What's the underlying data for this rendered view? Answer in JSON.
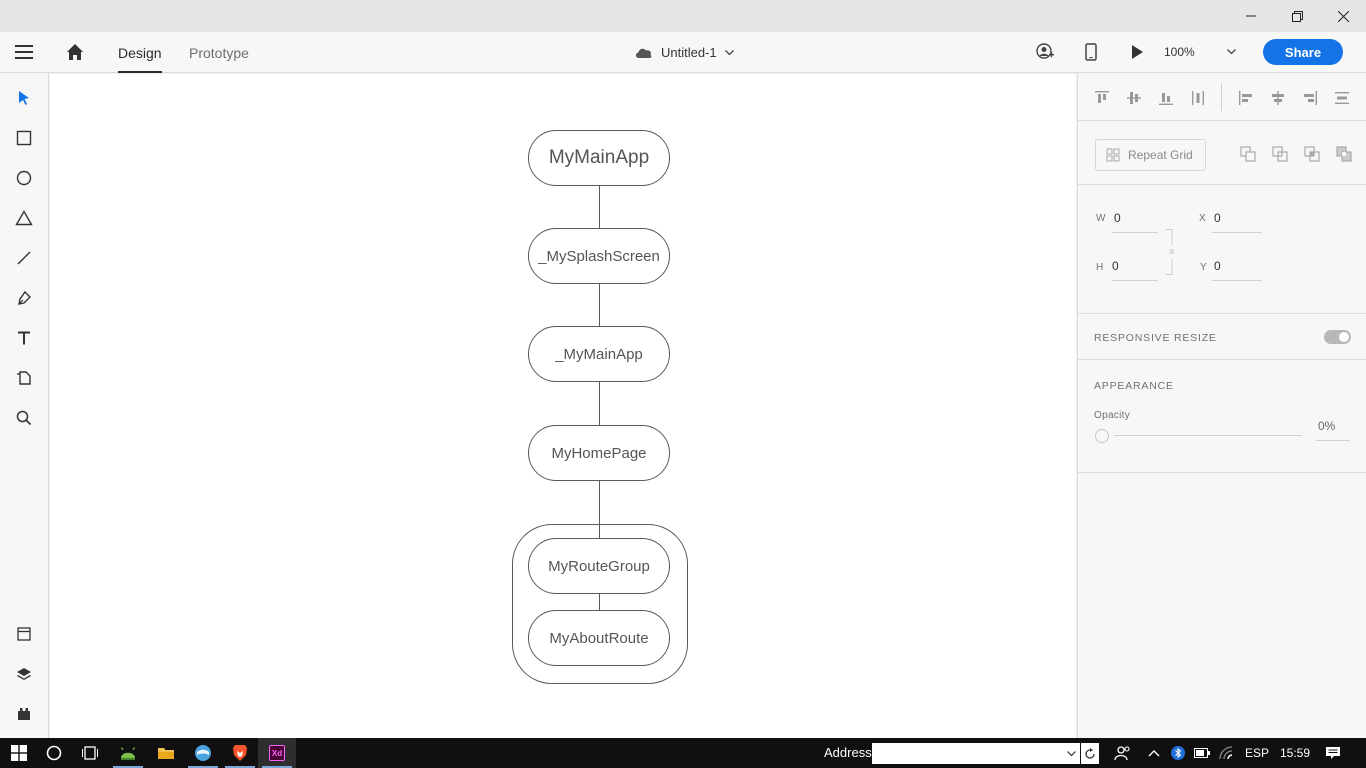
{
  "app": {
    "doc_title": "Untitled-1"
  },
  "tabs": {
    "design": "Design",
    "prototype": "Prototype"
  },
  "toolbar_right": {
    "zoom": "100%",
    "share": "Share"
  },
  "canvas": {
    "nodes": {
      "main_app": "MyMainApp",
      "splash": "_MySplashScreen",
      "priv_main_app": "_MyMainApp",
      "home_page": "MyHomePage",
      "route_group": "MyRouteGroup",
      "about_route": "MyAboutRoute"
    }
  },
  "panel": {
    "repeat_grid": "Repeat Grid",
    "w_label": "W",
    "w_value": "0",
    "h_label": "H",
    "h_value": "0",
    "x_label": "X",
    "x_value": "0",
    "y_label": "Y",
    "y_value": "0",
    "responsive_resize": "RESPONSIVE RESIZE",
    "appearance": "APPEARANCE",
    "opacity_label": "Opacity",
    "opacity_value": "0%"
  },
  "taskbar": {
    "address_label": "Address",
    "address_value": "",
    "language": "ESP",
    "time": "15:59"
  },
  "colors": {
    "accent": "#1473e6",
    "select_tool": "#1473e6"
  }
}
